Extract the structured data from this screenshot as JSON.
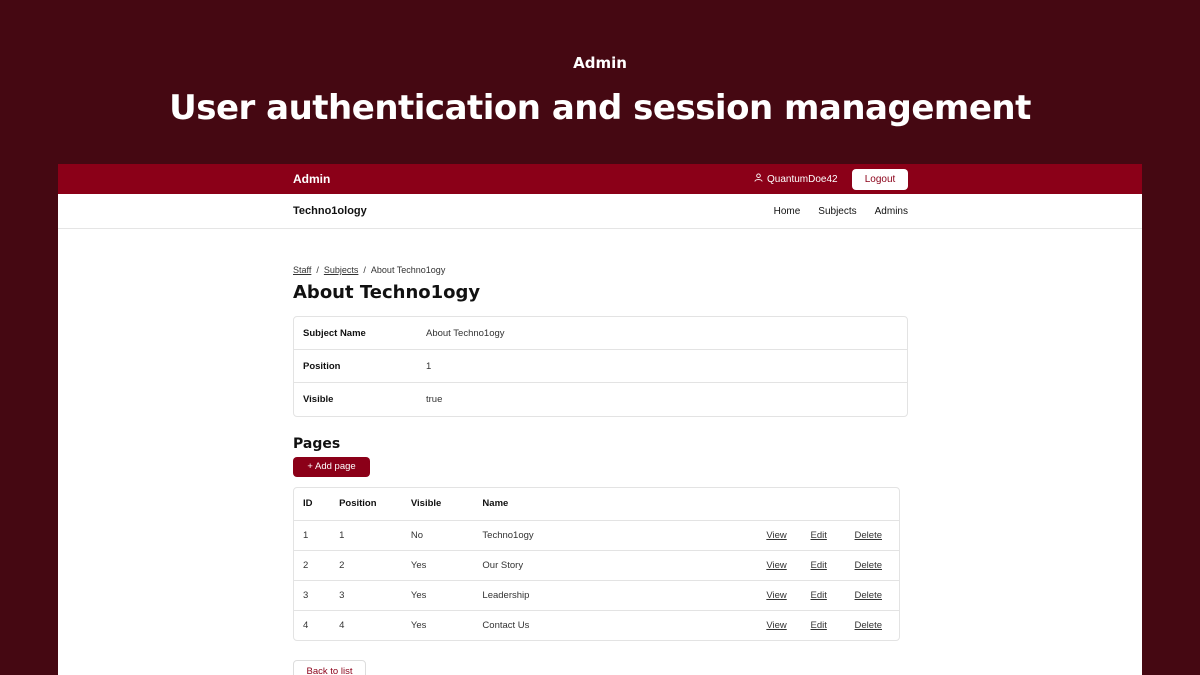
{
  "promo": {
    "eyebrow": "Admin",
    "title": "User authentication and session management"
  },
  "topbar": {
    "brand": "Admin",
    "username": "QuantumDoe42",
    "logout_label": "Logout"
  },
  "navbar": {
    "site_name": "Techno1ology",
    "links": [
      "Home",
      "Subjects",
      "Admins"
    ]
  },
  "breadcrumb": {
    "items": [
      "Staff",
      "Subjects",
      "About Techno1ogy"
    ],
    "separator": "/"
  },
  "page_title": "About Techno1ogy",
  "subject_details": [
    {
      "label": "Subject Name",
      "value": "About Techno1ogy"
    },
    {
      "label": "Position",
      "value": "1"
    },
    {
      "label": "Visible",
      "value": "true"
    }
  ],
  "pages_section": {
    "heading": "Pages",
    "add_label": "+ Add page",
    "columns": [
      "ID",
      "Position",
      "Visible",
      "Name"
    ],
    "rows": [
      {
        "id": "1",
        "position": "1",
        "visible": "No",
        "name": "Techno1ogy"
      },
      {
        "id": "2",
        "position": "2",
        "visible": "Yes",
        "name": "Our Story"
      },
      {
        "id": "3",
        "position": "3",
        "visible": "Yes",
        "name": "Leadership"
      },
      {
        "id": "4",
        "position": "4",
        "visible": "Yes",
        "name": "Contact Us"
      }
    ],
    "actions": {
      "view": "View",
      "edit": "Edit",
      "delete": "Delete"
    }
  },
  "back_label": "Back to list",
  "colors": {
    "background": "#450812",
    "brand": "#8b0018"
  },
  "icons": {
    "user": "user-icon"
  }
}
